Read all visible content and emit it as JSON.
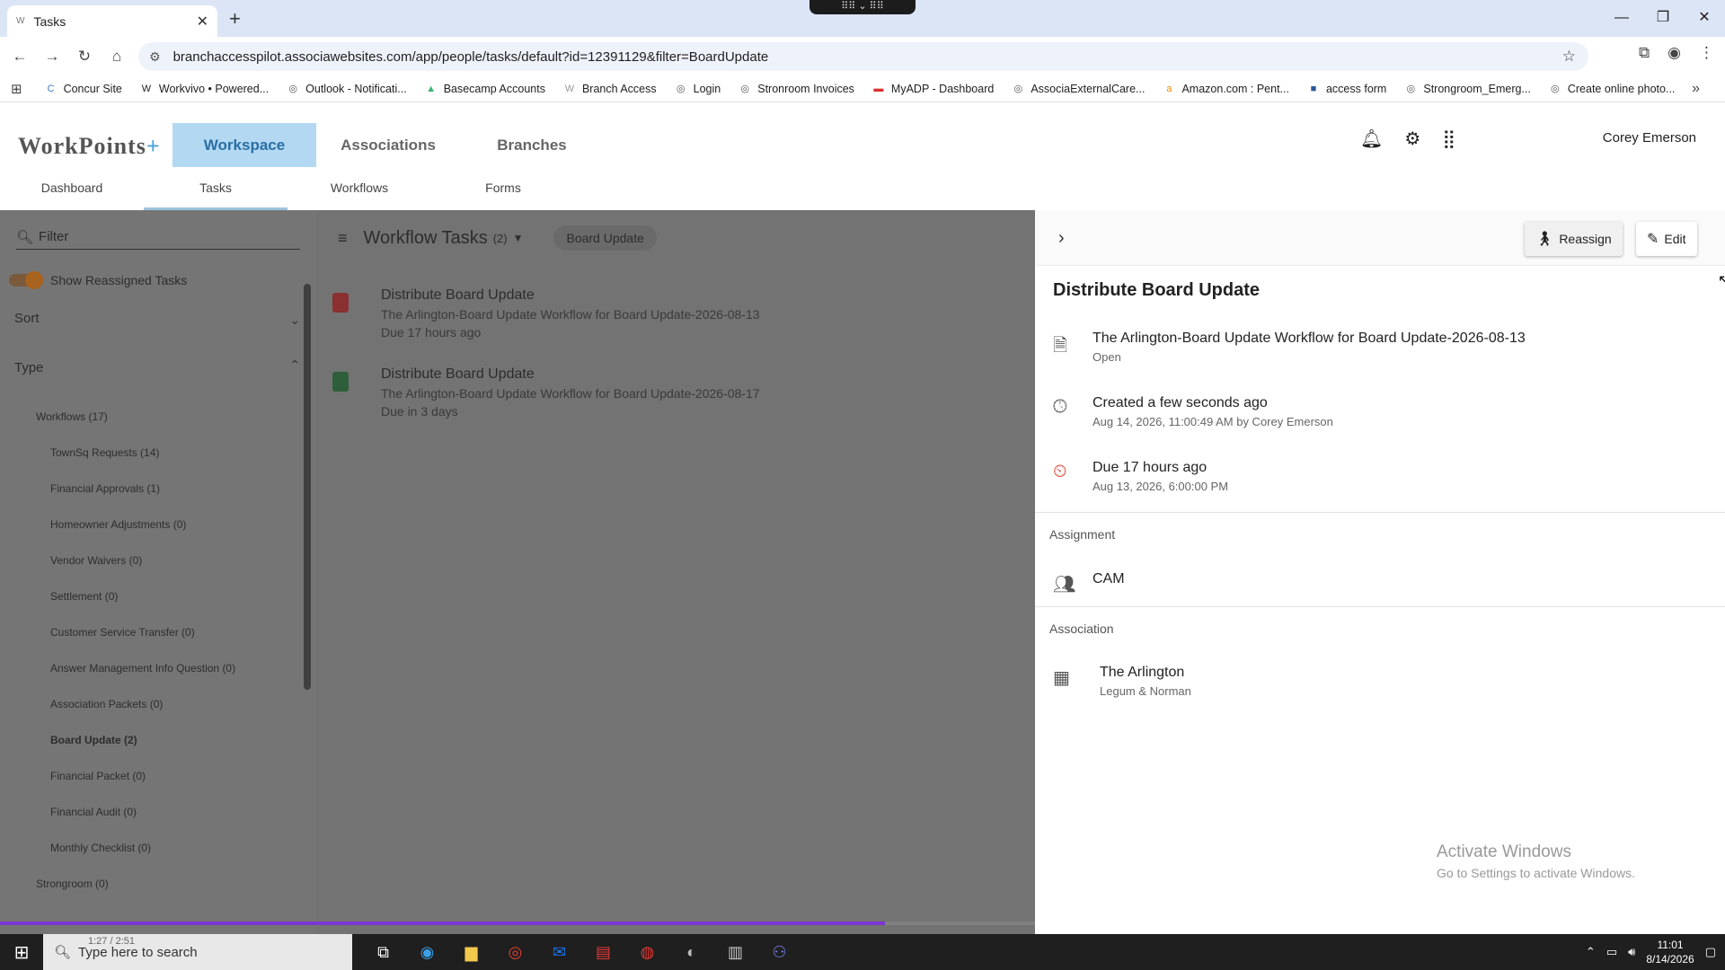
{
  "browser": {
    "tab_title": "Tasks",
    "tab_favicon": "W",
    "url": "branchaccesspilot.associawebsites.com/app/people/tasks/default?id=12391129&filter=BoardUpdate",
    "bookmarks": [
      {
        "label": "Concur Site",
        "icon": "C",
        "color": "#3a7bd5"
      },
      {
        "label": "Workvivo • Powered...",
        "icon": "W",
        "color": "#222"
      },
      {
        "label": "Outlook - Notificati...",
        "icon": "◎",
        "color": "#555"
      },
      {
        "label": "Basecamp Accounts",
        "icon": "▲",
        "color": "#3cb371"
      },
      {
        "label": "Branch Access",
        "icon": "W",
        "color": "#999"
      },
      {
        "label": "Login",
        "icon": "◎",
        "color": "#555"
      },
      {
        "label": "Stronroom Invoices",
        "icon": "◎",
        "color": "#555"
      },
      {
        "label": "MyADP - Dashboard",
        "icon": "▬",
        "color": "#d9302c"
      },
      {
        "label": "AssociaExternalCare...",
        "icon": "◎",
        "color": "#555"
      },
      {
        "label": "Amazon.com : Pent...",
        "icon": "a",
        "color": "#f08a00"
      },
      {
        "label": "access form",
        "icon": "■",
        "color": "#2b579a"
      },
      {
        "label": "Strongroom_Emerg...",
        "icon": "◎",
        "color": "#555"
      },
      {
        "label": "Create online photo...",
        "icon": "◎",
        "color": "#555"
      }
    ]
  },
  "app": {
    "logo_main": "WorkPoints",
    "logo_plus": "+",
    "main_nav": [
      "Workspace",
      "Associations",
      "Branches"
    ],
    "sub_nav": [
      "Dashboard",
      "Tasks",
      "Workflows",
      "Forms"
    ],
    "user": "Corey Emerson"
  },
  "left": {
    "filter_placeholder": "Filter",
    "show_reassigned": "Show Reassigned Tasks",
    "sort_label": "Sort",
    "type_label": "Type",
    "types": [
      {
        "label": "Workflows (17)",
        "level": 1,
        "bold": false
      },
      {
        "label": "TownSq Requests (14)",
        "level": 2,
        "bold": false
      },
      {
        "label": "Financial Approvals (1)",
        "level": 2,
        "bold": false
      },
      {
        "label": "Homeowner Adjustments (0)",
        "level": 2,
        "bold": false
      },
      {
        "label": "Vendor Waivers (0)",
        "level": 2,
        "bold": false
      },
      {
        "label": "Settlement (0)",
        "level": 2,
        "bold": false
      },
      {
        "label": "Customer Service Transfer (0)",
        "level": 2,
        "bold": false
      },
      {
        "label": "Answer Management Info Question (0)",
        "level": 2,
        "bold": false
      },
      {
        "label": "Association Packets (0)",
        "level": 2,
        "bold": false
      },
      {
        "label": "Board Update (2)",
        "level": 2,
        "bold": true
      },
      {
        "label": "Financial Packet (0)",
        "level": 2,
        "bold": false
      },
      {
        "label": "Financial Audit (0)",
        "level": 2,
        "bold": false
      },
      {
        "label": "Monthly Checklist (0)",
        "level": 2,
        "bold": false
      },
      {
        "label": "Strongroom (0)",
        "level": 1,
        "bold": false
      }
    ]
  },
  "middle": {
    "title": "Workflow Tasks",
    "count": "(2)",
    "chip": "Board Update",
    "tasks": [
      {
        "title": "Distribute Board Update",
        "workflow": "The Arlington-Board Update Workflow for Board Update-2026-08-13",
        "due": "Due 17 hours ago",
        "icon_color": "#8a3030"
      },
      {
        "title": "Distribute Board Update",
        "workflow": "The Arlington-Board Update Workflow for Board Update-2026-08-17",
        "due": "Due in 3 days",
        "icon_color": "#2e5f3a"
      }
    ]
  },
  "detail": {
    "reassign": "Reassign",
    "edit": "Edit",
    "title": "Distribute Board Update",
    "workflow": "The Arlington-Board Update Workflow for Board Update-2026-08-13",
    "status": "Open",
    "created": "Created a few seconds ago",
    "created_detail": "Aug 14, 2026, 11:00:49 AM by Corey Emerson",
    "due": "Due 17 hours ago",
    "due_detail": "Aug 13, 2026, 6:00:00 PM",
    "assignment_label": "Assignment",
    "assignee": "CAM",
    "association_label": "Association",
    "association": "The Arlington",
    "association_sub": "Legum & Norman"
  },
  "watermark": {
    "line1": "Activate Windows",
    "line2": "Go to Settings to activate Windows."
  },
  "taskbar": {
    "search_placeholder": "Type here to search",
    "media_time": "1:27 / 2:51",
    "time": "11:01",
    "date": "8/14/2026"
  },
  "progress": {
    "fraction": 0.855
  }
}
